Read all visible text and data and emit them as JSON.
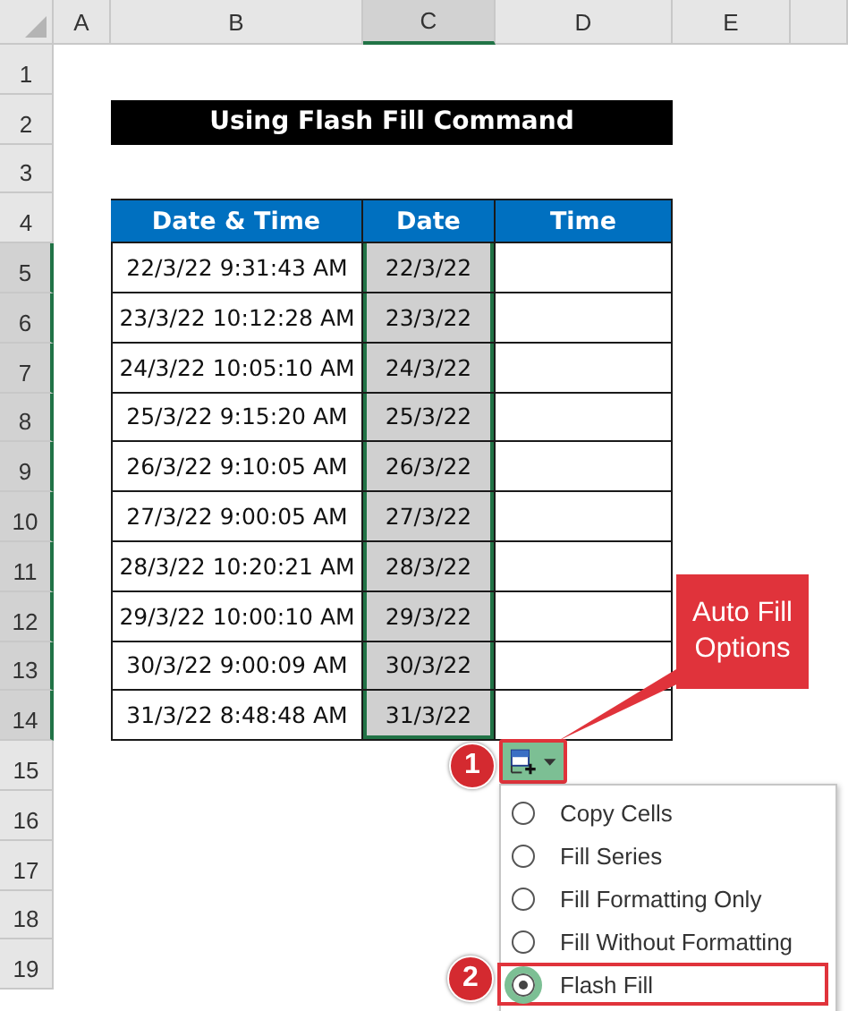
{
  "column_headers": [
    {
      "label": "A",
      "selected": false
    },
    {
      "label": "B",
      "selected": false
    },
    {
      "label": "C",
      "selected": true
    },
    {
      "label": "D",
      "selected": false
    },
    {
      "label": "E",
      "selected": false
    }
  ],
  "row_headers": [
    {
      "label": "1",
      "selected": false
    },
    {
      "label": "2",
      "selected": false
    },
    {
      "label": "3",
      "selected": false
    },
    {
      "label": "4",
      "selected": false
    },
    {
      "label": "5",
      "selected": true
    },
    {
      "label": "6",
      "selected": true
    },
    {
      "label": "7",
      "selected": true
    },
    {
      "label": "8",
      "selected": true
    },
    {
      "label": "9",
      "selected": true
    },
    {
      "label": "10",
      "selected": true
    },
    {
      "label": "11",
      "selected": true
    },
    {
      "label": "12",
      "selected": true
    },
    {
      "label": "13",
      "selected": true
    },
    {
      "label": "14",
      "selected": true
    },
    {
      "label": "15",
      "selected": false
    },
    {
      "label": "16",
      "selected": false
    },
    {
      "label": "17",
      "selected": false
    },
    {
      "label": "18",
      "selected": false
    },
    {
      "label": "19",
      "selected": false
    }
  ],
  "title": "Using Flash Fill Command",
  "table": {
    "columns": [
      "Date & Time",
      "Date",
      "Time"
    ],
    "rows": [
      {
        "date_time": "22/3/22 9:31:43 AM",
        "date": "22/3/22",
        "selected": true
      },
      {
        "date_time": "23/3/22 10:12:28 AM",
        "date": "23/3/22",
        "selected": true
      },
      {
        "date_time": "24/3/22 10:05:10 AM",
        "date": "24/3/22",
        "selected": true
      },
      {
        "date_time": "25/3/22 9:15:20 AM",
        "date": "25/3/22",
        "selected": true
      },
      {
        "date_time": "26/3/22 9:10:05 AM",
        "date": "26/3/22",
        "selected": true
      },
      {
        "date_time": "27/3/22 9:00:05 AM",
        "date": "27/3/22",
        "selected": true
      },
      {
        "date_time": "28/3/22 10:20:21 AM",
        "date": "28/3/22",
        "selected": true
      },
      {
        "date_time": "29/3/22 10:00:10 AM",
        "date": "29/3/22",
        "selected": true
      },
      {
        "date_time": "30/3/22 9:00:09 AM",
        "date": "30/3/22",
        "selected": true
      },
      {
        "date_time": "31/3/22 8:48:48 AM",
        "date": "31/3/22",
        "selected": true
      }
    ]
  },
  "callout": {
    "text": "Auto Fill Options"
  },
  "auto_fill_button": {
    "badge": "1"
  },
  "menu": {
    "items": [
      {
        "label": "Copy Cells",
        "selected": false
      },
      {
        "label": "Fill Series",
        "selected": false
      },
      {
        "label": "Fill Formatting Only",
        "selected": false
      },
      {
        "label": "Fill Without Formatting",
        "selected": false
      },
      {
        "label": "Flash Fill",
        "selected": true,
        "badge": "2"
      }
    ]
  }
}
